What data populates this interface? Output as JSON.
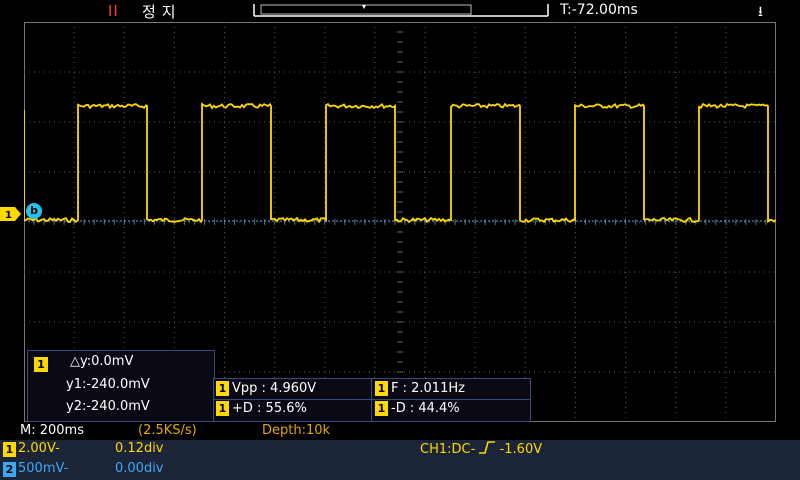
{
  "status_bar": {
    "run_icon": "II",
    "run_state": "정지",
    "trigger_time": "T:-72.00ms",
    "usb_icon": "usb-icon"
  },
  "channel_marker": {
    "label": "1"
  },
  "reference": {
    "label": "b"
  },
  "cursor_panel": {
    "channel": "1",
    "delta_y": "△y:0.0mV",
    "y1": "y1:-240.0mV",
    "y2": "y2:-240.0mV"
  },
  "measurements": [
    {
      "channel": "1",
      "text": "Vpp : 4.960V"
    },
    {
      "channel": "1",
      "text": "F : 2.011Hz"
    },
    {
      "channel": "1",
      "text": "+D : 55.6%"
    },
    {
      "channel": "1",
      "text": "-D : 44.4%"
    }
  ],
  "acquisition": {
    "timebase": "M: 200ms",
    "sample_rate": "(2.5KS/s)",
    "depth": "Depth:10k"
  },
  "channels": [
    {
      "id": "1",
      "scale": "2.00V-",
      "offset": "0.12div",
      "color": "#ffd800"
    },
    {
      "id": "2",
      "scale": "500mV-",
      "offset": "0.00div",
      "color": "#3da9f5"
    }
  ],
  "trigger": {
    "text": "CH1:DC-",
    "edge": "rising",
    "level": "-1.60V"
  },
  "colors": {
    "ch1": "#ffd800",
    "ch2": "#3da9f5",
    "grid": "#5a5a5a",
    "background": "#000000"
  },
  "waveform": {
    "type": "square",
    "frequency": "2.011Hz",
    "duty_positive": 55.6
  }
}
